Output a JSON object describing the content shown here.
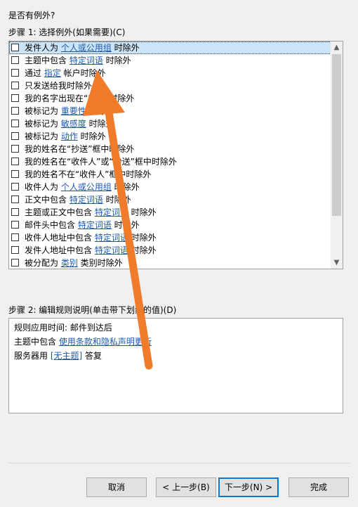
{
  "dialog": {
    "question": "是否有例外?",
    "step1_label": "步骤 1: 选择例外(如果需要)(C)",
    "step2_label": "步骤 2: 编辑规则说明(单击带下划线的值)(D)"
  },
  "exceptions": [
    {
      "pre": "发件人为 ",
      "link": "个人或公用组",
      "post": " 时除外",
      "checked": false,
      "selected": true
    },
    {
      "pre": "主题中包含 ",
      "link": "特定词语",
      "post": " 时除外",
      "checked": false
    },
    {
      "pre": "通过 ",
      "link": "指定",
      "post": " 帐户时除外",
      "checked": false
    },
    {
      "pre": "只发送给我时除外",
      "link": "",
      "post": "",
      "checked": false
    },
    {
      "pre": "我的名字出现在“",
      "link": "",
      "post": "”框中时除外",
      "checked": false
    },
    {
      "pre": "被标记为 ",
      "link": "重要性",
      "post": " 时除外",
      "checked": false
    },
    {
      "pre": "被标记为 ",
      "link": "敏感度",
      "post": " 时除外",
      "checked": false
    },
    {
      "pre": "被标记为 ",
      "link": "动作",
      "post": " 时除外",
      "checked": false
    },
    {
      "pre": "我的姓名在“抄送”框中时除外",
      "link": "",
      "post": "",
      "checked": false
    },
    {
      "pre": "我的姓名在“收件人”或“抄送”框中时除外",
      "link": "",
      "post": "",
      "checked": false
    },
    {
      "pre": "我的姓名不在“收件人”框中时除外",
      "link": "",
      "post": "",
      "checked": false
    },
    {
      "pre": "收件人为 ",
      "link": "个人或公用组",
      "post": " 时除外",
      "checked": false
    },
    {
      "pre": "正文中包含 ",
      "link": "特定词语",
      "post": " 时除外",
      "checked": false
    },
    {
      "pre": "主题或正文中包含 ",
      "link": "特定词语",
      "post": " 时除外",
      "checked": false
    },
    {
      "pre": "邮件头中包含 ",
      "link": "特定词语",
      "post": " 时除外",
      "checked": false
    },
    {
      "pre": "收件人地址中包含 ",
      "link": "特定词语",
      "post": " 时除外",
      "checked": false
    },
    {
      "pre": "发件人地址中包含 ",
      "link": "特定词语",
      "post": " 时除外",
      "checked": false
    },
    {
      "pre": "被分配为 ",
      "link": "类别",
      "post": " 类别时除外",
      "checked": false
    }
  ],
  "description": {
    "line1": "规则应用时间: 邮件到达后",
    "line2_pre": "主题中包含 ",
    "line2_link": "使用条款和隐私声明更新",
    "line3_pre": "服务器用 ",
    "line3_link": "[无主题]",
    "line3_post": " 答复"
  },
  "buttons": {
    "cancel": "取消",
    "back": "< 上一步(B)",
    "next": "下一步(N) >",
    "finish": "完成"
  },
  "scrollbar": {
    "up_icon": "▲",
    "down_icon": "▼"
  },
  "colors": {
    "accent": "#0078d7",
    "link": "#1f5aa8",
    "annotation_arrow": "#f07b2b"
  }
}
